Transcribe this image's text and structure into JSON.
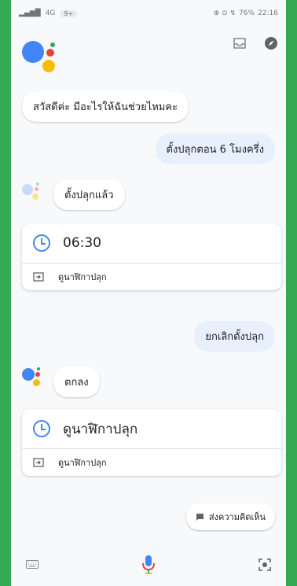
{
  "status_bar": {
    "left_text": "4G",
    "network_badge": "9+",
    "right_icons": "⊕ ⊙ ↯",
    "battery": "76%",
    "time": "22:16"
  },
  "colors": {
    "accent_blue": "#4285f4",
    "brand_red": "#ea4335",
    "brand_yellow": "#fbbc05",
    "brand_green": "#34a853"
  },
  "greeting": "สวัสดีค่ะ มีอะไรให้ฉันช่วยไหมคะ",
  "messages": [
    {
      "user": "ตั้งปลุกตอน 6 โมงครึ่ง",
      "assistant": "ตั้งปลุกแล้ว"
    },
    {
      "user": "ยกเลิกตั้งปลุก",
      "assistant": "ตกลง"
    }
  ],
  "cards": [
    {
      "title": "06:30",
      "action": "ดูนาฬิกาปลุก"
    },
    {
      "title": "ดูนาฬิกาปลุก",
      "action": "ดูนาฬิกาปลุก"
    }
  ],
  "feedback_label": "ส่งความคิดเห็น",
  "icons": {
    "inbox": "inbox-icon",
    "explore": "compass-icon",
    "keyboard": "keyboard-icon",
    "mic": "mic-icon",
    "lens": "lens-icon",
    "clock": "clock-icon",
    "open_app": "open-app-icon",
    "feedback": "feedback-icon"
  }
}
